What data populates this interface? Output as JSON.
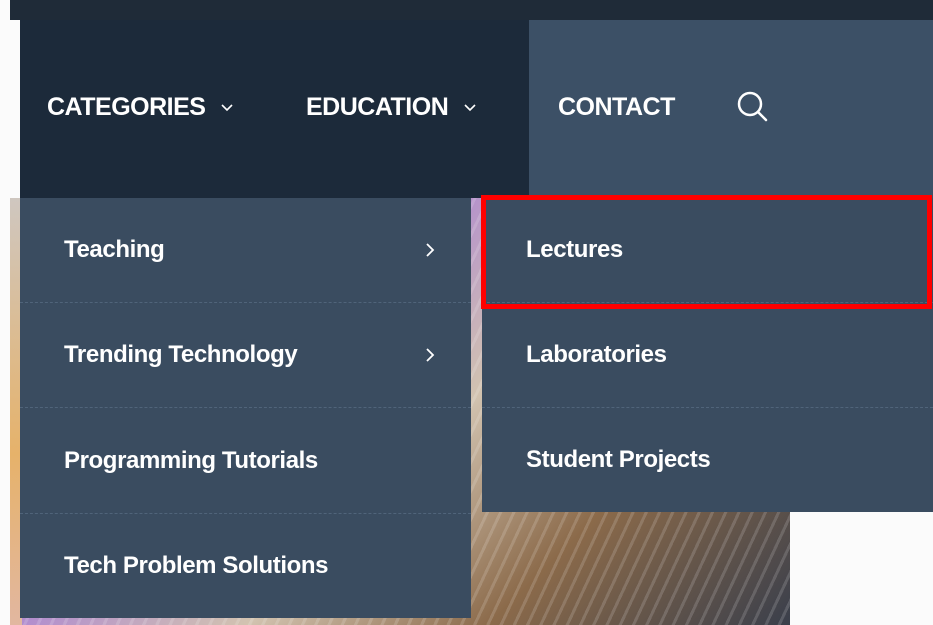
{
  "nav": {
    "items": [
      {
        "label": "CATEGORIES",
        "has_dropdown": true
      },
      {
        "label": "EDUCATION",
        "has_dropdown": true
      },
      {
        "label": "CONTACT",
        "has_dropdown": false
      }
    ],
    "search_icon": "search-icon"
  },
  "categories_menu": {
    "items": [
      {
        "label": "Teaching",
        "has_submenu": true
      },
      {
        "label": "Trending Technology",
        "has_submenu": true
      },
      {
        "label": "Programming Tutorials",
        "has_submenu": false
      },
      {
        "label": "Tech Problem Solutions",
        "has_submenu": false
      }
    ]
  },
  "teaching_submenu": {
    "items": [
      {
        "label": "Lectures",
        "highlighted": true
      },
      {
        "label": "Laboratories",
        "highlighted": false
      },
      {
        "label": "Student Projects",
        "highlighted": false
      }
    ]
  },
  "colors": {
    "nav_dark": "#1c2a3a",
    "nav_light": "#3c5066",
    "menu_bg": "#3a4c60",
    "highlight": "#ff0000"
  }
}
